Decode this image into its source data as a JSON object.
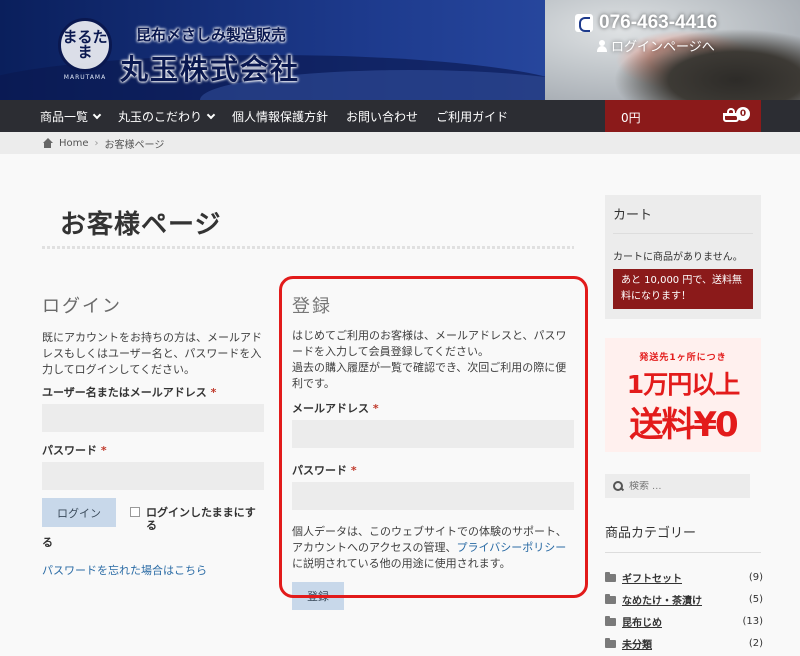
{
  "header": {
    "tagline": "昆布〆さしみ製造販売",
    "brand_name": "丸玉株式会社",
    "logo_text": "まるたま",
    "logo_sub": "MARUTAMA",
    "phone": "076-463-4416",
    "login_link": "ログインページへ",
    "colors": {
      "header_blue": "#1d3a8c",
      "nav_dark": "#2c2d33",
      "cart_red": "#8b1a1a",
      "accent_red": "#e21b1b"
    }
  },
  "nav": {
    "items": [
      {
        "label": "商品一覧",
        "has_dropdown": true,
        "icon": "chevron-down-icon"
      },
      {
        "label": "丸玉のこだわり",
        "has_dropdown": true,
        "icon": "chevron-down-icon"
      },
      {
        "label": "個人情報保護方針",
        "has_dropdown": false
      },
      {
        "label": "お問い合わせ",
        "has_dropdown": false
      },
      {
        "label": "ご利用ガイド",
        "has_dropdown": false
      }
    ],
    "cart_amount": "0円",
    "cart_count": "0"
  },
  "breadcrumb": {
    "home": "Home",
    "separator": "›",
    "current": "お客様ページ"
  },
  "page": {
    "title": "お客様ページ"
  },
  "login": {
    "heading": "ログイン",
    "description": "既にアカウントをお持ちの方は、メールアドレスもしくはユーザー名と、パスワードを入力してログインしてください。",
    "username_label": "ユーザー名またはメールアドレス",
    "password_label": "パスワード",
    "required_mark": "*",
    "submit_label": "ログイン",
    "remember_label": "ログインしたままにする",
    "lost_password": "パスワードを忘れた場合はこちら"
  },
  "register": {
    "heading": "登録",
    "description1": "はじめてご利用のお客様は、メールアドレスと、パスワードを入力して会員登録してください。",
    "description2": "過去の購入履歴が一覧で確認でき、次回ご利用の際に便利です。",
    "email_label": "メールアドレス",
    "password_label": "パスワード",
    "required_mark": "*",
    "privacy_before": "個人データは、このウェブサイトでの体験のサポート、アカウントへのアクセスの管理、",
    "privacy_link": "プライバシーポリシー",
    "privacy_after": " に説明されている他の用途に使用されます。",
    "submit_label": "登録"
  },
  "sidebar": {
    "cart_title": "カート",
    "cart_empty": "カートに商品がありません。",
    "free_shipping": "あと 10,000 円で、送料無料になります！",
    "banner_top": "発送先1ヶ所につき",
    "banner_mid": "1万円以上",
    "banner_bot": "送料¥0",
    "search_placeholder": "検索 …",
    "categories_title": "商品カテゴリー",
    "categories": [
      {
        "name": "ギフトセット",
        "count": "(9)"
      },
      {
        "name": "なめたけ・茶漬け",
        "count": "(5)"
      },
      {
        "name": "昆布じめ",
        "count": "(13)"
      },
      {
        "name": "未分類",
        "count": "(2)"
      }
    ]
  }
}
